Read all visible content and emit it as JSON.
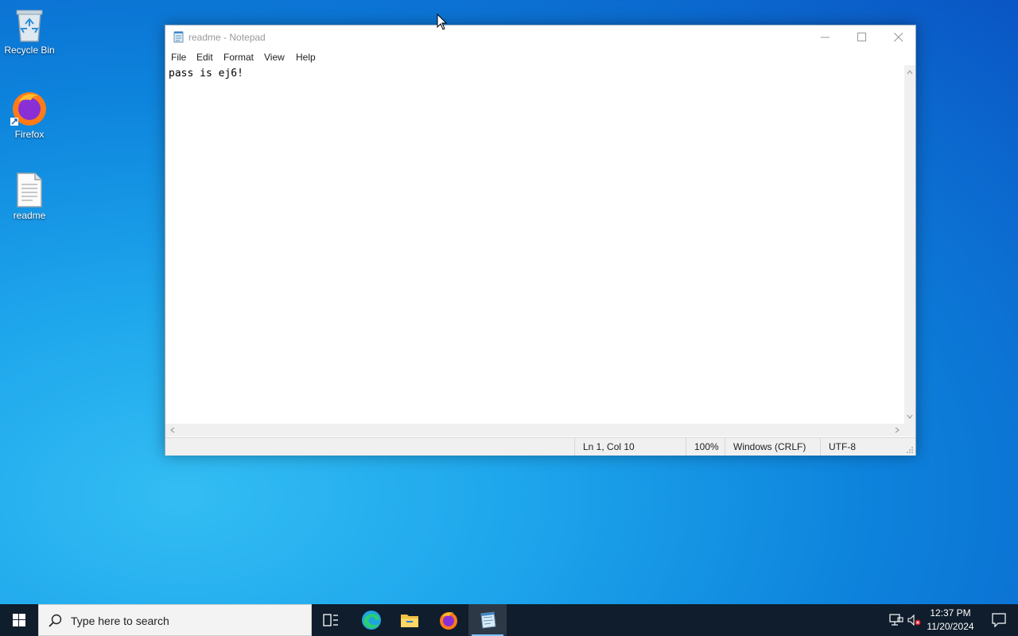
{
  "desktop": {
    "icons": [
      {
        "label": "Recycle Bin",
        "icon": "recycle-bin-icon"
      },
      {
        "label": "Firefox",
        "icon": "firefox-icon"
      },
      {
        "label": "readme",
        "icon": "text-file-icon"
      }
    ]
  },
  "notepad": {
    "title": "readme - Notepad",
    "menu": [
      "File",
      "Edit",
      "Format",
      "View",
      "Help"
    ],
    "content": "pass is ej6!",
    "status": {
      "position": "Ln 1, Col 10",
      "zoom": "100%",
      "line_ending": "Windows (CRLF)",
      "encoding": "UTF-8"
    }
  },
  "taskbar": {
    "search_placeholder": "Type here to search",
    "apps": [
      "task-view-icon",
      "edge-icon",
      "file-explorer-icon",
      "firefox-icon",
      "notepad-icon"
    ],
    "active_app": "notepad-icon",
    "time": "12:37 PM",
    "date": "11/20/2024"
  },
  "colors": {
    "taskbar": "#0f1d2c",
    "desktop_accent": "#1ea6ec"
  }
}
